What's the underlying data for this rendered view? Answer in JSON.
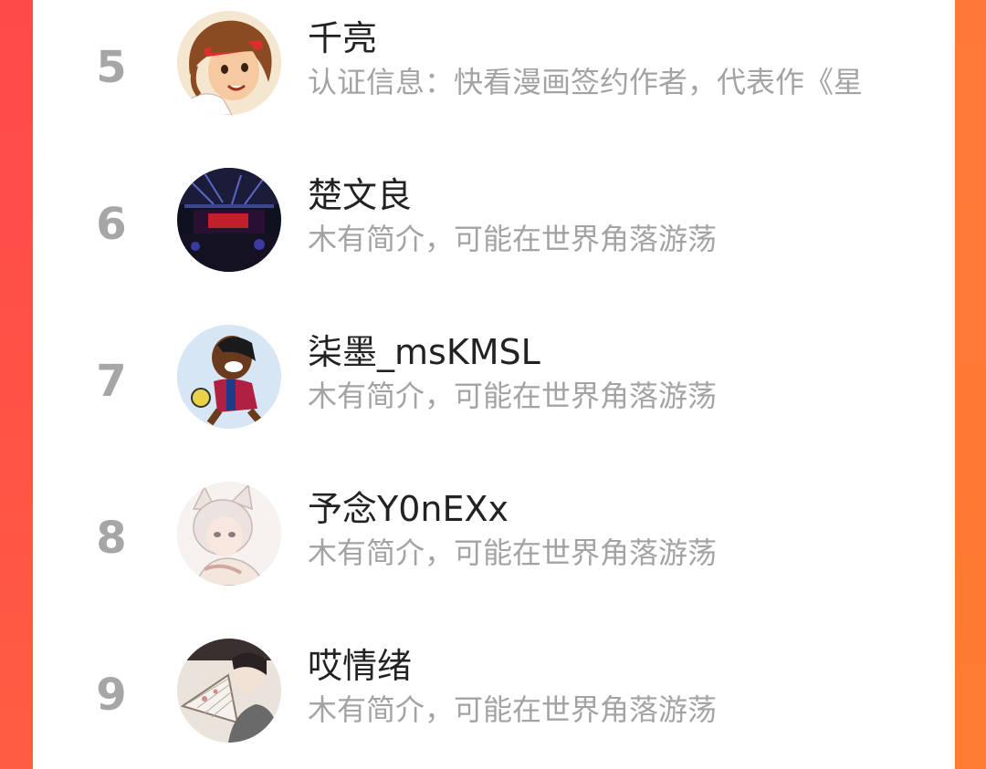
{
  "colors": {
    "frame_left": "#ff4d45",
    "frame_right": "#ff7a35",
    "card_bg": "#ffffff",
    "rank": "#a6a6a6",
    "name": "#222222",
    "desc": "#a3a3a3"
  },
  "list": {
    "items": [
      {
        "rank": "5",
        "name": "千亮",
        "desc": "认证信息：快看漫画签约作者，代表作《星",
        "avatar_icon": "manga-character-headband-avatar"
      },
      {
        "rank": "6",
        "name": "楚文良",
        "desc": "木有简介，可能在世界角落游荡",
        "avatar_icon": "concert-stage-avatar"
      },
      {
        "rank": "7",
        "name": "柒墨_msKMSL",
        "desc": "木有简介，可能在世界角落游荡",
        "avatar_icon": "cartoon-footballer-avatar"
      },
      {
        "rank": "8",
        "name": "予念Y0nEXx",
        "desc": "木有简介，可能在世界角落游荡",
        "avatar_icon": "anime-catboy-avatar"
      },
      {
        "rank": "9",
        "name": "哎情绪",
        "desc": "木有简介，可能在世界角落游荡",
        "avatar_icon": "girl-with-fan-avatar"
      }
    ]
  }
}
